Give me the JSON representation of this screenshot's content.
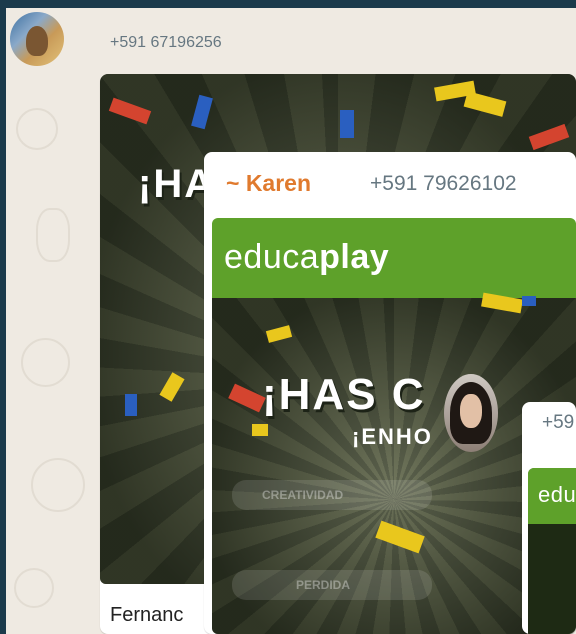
{
  "messages": [
    {
      "phone": "+591 67196256",
      "headline": "¡HA",
      "caption": "Fernanc"
    },
    {
      "sender": "~ Karen",
      "phone": "+591 79626102",
      "headline": "¡HAS C",
      "subheadline": "¡ENHO",
      "stat_labels": [
        "CREATIVIDAD",
        "PERDIDA"
      ]
    },
    {
      "phone": "+59"
    }
  ],
  "brand": {
    "name": "educaplay",
    "name_part1": "educa",
    "name_part2": "play",
    "truncated": "edu"
  },
  "colors": {
    "app_bg": "#1b3a4b",
    "chat_bg": "#efeae2",
    "sender": "#e07a2e",
    "educaplay_green": "#5ea12a"
  }
}
